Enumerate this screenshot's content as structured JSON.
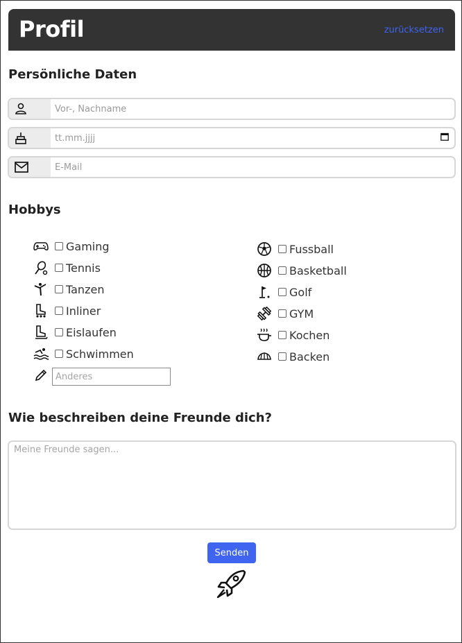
{
  "header": {
    "title": "Profil",
    "reset_label": "zurücksetzen"
  },
  "personal": {
    "heading": "Persönliche Daten",
    "name_placeholder": "Vor-, Nachname",
    "date_placeholder": "tt.mm.jjjj",
    "email_placeholder": "E-Mail"
  },
  "hobbies": {
    "heading": "Hobbys",
    "left": [
      {
        "label": "Gaming",
        "icon": "gamepad-icon"
      },
      {
        "label": "Tennis",
        "icon": "tennis-racket-icon"
      },
      {
        "label": "Tanzen",
        "icon": "dance-icon"
      },
      {
        "label": "Inliner",
        "icon": "inline-skate-icon"
      },
      {
        "label": "Eislaufen",
        "icon": "ice-skate-icon"
      },
      {
        "label": "Schwimmen",
        "icon": "swimming-icon"
      }
    ],
    "right": [
      {
        "label": "Fussball",
        "icon": "soccer-ball-icon"
      },
      {
        "label": "Basketball",
        "icon": "basketball-icon"
      },
      {
        "label": "Golf",
        "icon": "golf-flag-icon"
      },
      {
        "label": "GYM",
        "icon": "dumbbell-icon"
      },
      {
        "label": "Kochen",
        "icon": "cooking-pot-icon"
      },
      {
        "label": "Backen",
        "icon": "croissant-icon"
      }
    ],
    "other_placeholder": "Anderes"
  },
  "friends": {
    "heading": "Wie beschreiben deine Freunde dich?",
    "placeholder": "Meine Freunde sagen..."
  },
  "submit": {
    "label": "Senden"
  },
  "colors": {
    "header_bg": "#333333",
    "accent": "#3e64f0"
  }
}
